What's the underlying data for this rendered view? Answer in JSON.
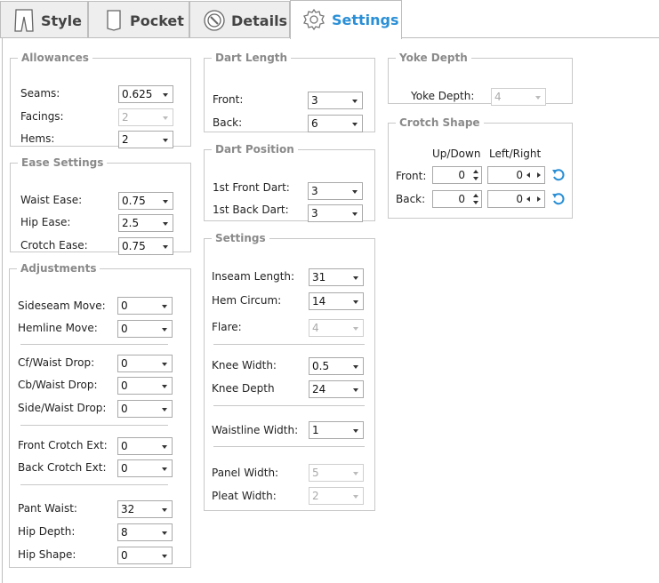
{
  "tabs": [
    {
      "label": "Style"
    },
    {
      "label": "Pocket"
    },
    {
      "label": "Details"
    },
    {
      "label": "Settings"
    }
  ],
  "accent_color": "#2a8fd6",
  "allowances": {
    "legend": "Allowances",
    "seams_label": "Seams:",
    "seams_value": "0.625",
    "facings_label": "Facings:",
    "facings_value": "2",
    "hems_label": "Hems:",
    "hems_value": "2"
  },
  "ease": {
    "legend": "Ease Settings",
    "waist_label": "Waist Ease:",
    "waist_value": "0.75",
    "hip_label": "Hip Ease:",
    "hip_value": "2.5",
    "crotch_label": "Crotch Ease:",
    "crotch_value": "0.75"
  },
  "adjustments": {
    "legend": "Adjustments",
    "sideseam_label": "Sideseam Move:",
    "sideseam_value": "0",
    "hemline_label": "Hemline Move:",
    "hemline_value": "0",
    "cf_label": "Cf/Waist Drop:",
    "cf_value": "0",
    "cb_label": "Cb/Waist Drop:",
    "cb_value": "0",
    "side_label": "Side/Waist Drop:",
    "side_value": "0",
    "front_crotch_label": "Front Crotch Ext:",
    "front_crotch_value": "0",
    "back_crotch_label": "Back Crotch Ext:",
    "back_crotch_value": "0",
    "pant_waist_label": "Pant Waist:",
    "pant_waist_value": "32",
    "hip_depth_label": "Hip Depth:",
    "hip_depth_value": "8",
    "hip_shape_label": "Hip Shape:",
    "hip_shape_value": "0"
  },
  "dart_length": {
    "legend": "Dart Length",
    "front_label": "Front:",
    "front_value": "3",
    "back_label": "Back:",
    "back_value": "6"
  },
  "dart_position": {
    "legend": "Dart Position",
    "first_front_label": "1st Front Dart:",
    "first_front_value": "3",
    "first_back_label": "1st Back Dart:",
    "first_back_value": "3"
  },
  "settings": {
    "legend": "Settings",
    "inseam_label": "Inseam Length:",
    "inseam_value": "31",
    "hem_label": "Hem Circum:",
    "hem_value": "14",
    "flare_label": "Flare:",
    "flare_value": "4",
    "knee_width_label": "Knee Width:",
    "knee_width_value": "0.5",
    "knee_depth_label": "Knee Depth",
    "knee_depth_value": "24",
    "waistline_label": "Waistline Width:",
    "waistline_value": "1",
    "panel_label": "Panel Width:",
    "panel_value": "5",
    "pleat_label": "Pleat Width:",
    "pleat_value": "2"
  },
  "yoke": {
    "legend": "Yoke Depth",
    "label": "Yoke Depth:",
    "value": "4"
  },
  "crotch_shape": {
    "legend": "Crotch Shape",
    "col_updown": "Up/Down",
    "col_leftright": "Left/Right",
    "front_label": "Front:",
    "front_ud": "0",
    "front_lr": "0",
    "back_label": "Back:",
    "back_ud": "0",
    "back_lr": "0"
  }
}
